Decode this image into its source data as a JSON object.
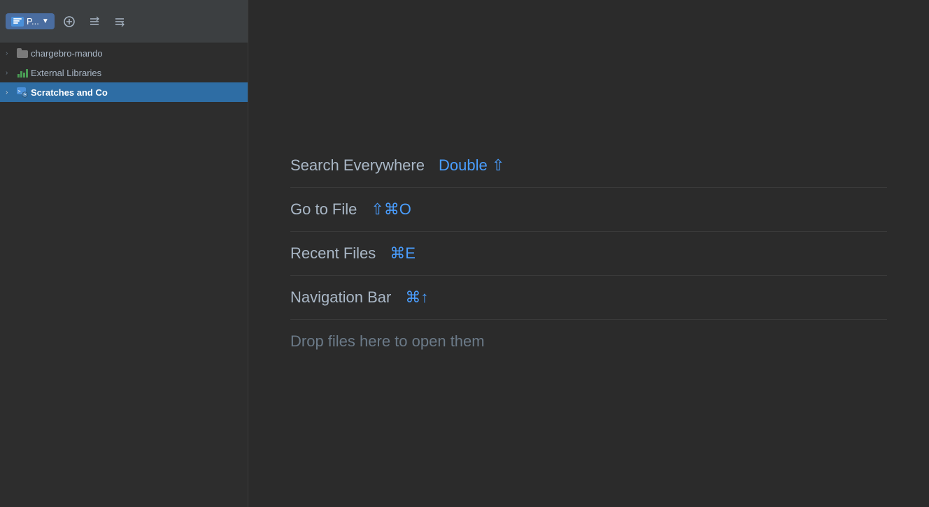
{
  "toolbar": {
    "project_btn_label": "P...",
    "dropdown_icon": "▼",
    "icon1": "⊕",
    "icon2": "≡↓",
    "icon3": "≡↑"
  },
  "sidebar": {
    "items": [
      {
        "id": "chargebro",
        "label": "chargebro-mando",
        "icon": "folder",
        "selected": false
      },
      {
        "id": "external-libraries",
        "label": "External Libraries",
        "icon": "barchart",
        "selected": false
      },
      {
        "id": "scratches",
        "label": "Scratches and Co",
        "icon": "scratches",
        "selected": true
      }
    ]
  },
  "main": {
    "search_everywhere_label": "Search Everywhere",
    "search_everywhere_keys": "Double ⇧",
    "go_to_file_label": "Go to File",
    "go_to_file_keys": "⇧⌘O",
    "recent_files_label": "Recent Files",
    "recent_files_keys": "⌘E",
    "navigation_bar_label": "Navigation Bar",
    "navigation_bar_keys": "⌘↑",
    "drop_files_label": "Drop files here to open them"
  }
}
